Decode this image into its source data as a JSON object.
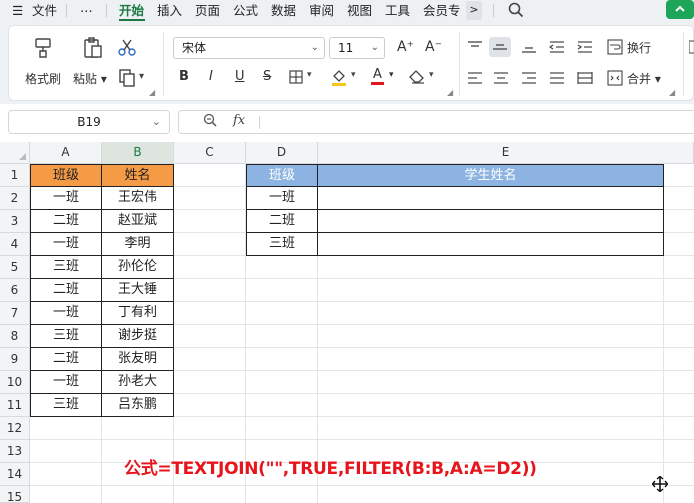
{
  "menubar": {
    "hamburger": "☰",
    "file": "文件",
    "more": "⋯",
    "tabs": [
      "开始",
      "插入",
      "页面",
      "公式",
      "数据",
      "审阅",
      "视图",
      "工具",
      "会员专"
    ],
    "active_tab": "开始",
    "overflow": ">",
    "search_icon": "search-icon",
    "green_btn_icon": "chevron-icon"
  },
  "ribbon": {
    "format_painter": "格式刷",
    "paste": "粘贴",
    "font_name": "宋体",
    "font_size": "11",
    "wrap": "换行",
    "merge": "合并",
    "bold": "B",
    "italic": "I",
    "underline": "U",
    "strike": "S",
    "font_color_letter": "A",
    "grow": "A⁺",
    "shrink": "A⁻"
  },
  "formula_bar": {
    "name_box": "B19",
    "fx": "fx",
    "value": ""
  },
  "columns": [
    "A",
    "B",
    "C",
    "D",
    "E"
  ],
  "rows": [
    "1",
    "2",
    "3",
    "4",
    "5",
    "6",
    "7",
    "8",
    "9",
    "10",
    "11",
    "12",
    "13",
    "14",
    "15"
  ],
  "table_left": {
    "headers": [
      "班级",
      "姓名"
    ],
    "rows": [
      [
        "一班",
        "王宏伟"
      ],
      [
        "二班",
        "赵亚斌"
      ],
      [
        "一班",
        "李明"
      ],
      [
        "三班",
        "孙伦伦"
      ],
      [
        "二班",
        "王大锤"
      ],
      [
        "一班",
        "丁有利"
      ],
      [
        "三班",
        "谢步挺"
      ],
      [
        "二班",
        "张友明"
      ],
      [
        "一班",
        "孙老大"
      ],
      [
        "三班",
        "吕东鹏"
      ]
    ]
  },
  "table_right": {
    "headers": [
      "班级",
      "学生姓名"
    ],
    "rows": [
      [
        "一班",
        ""
      ],
      [
        "二班",
        ""
      ],
      [
        "三班",
        ""
      ]
    ]
  },
  "note": "公式=TEXTJOIN(\"\",TRUE,FILTER(B:B,A:A=D2))",
  "colors": {
    "accent_green": "#1b7a42",
    "orange_header": "#f59a45",
    "blue_header": "#8db3e2",
    "note_red": "#e8141c"
  }
}
